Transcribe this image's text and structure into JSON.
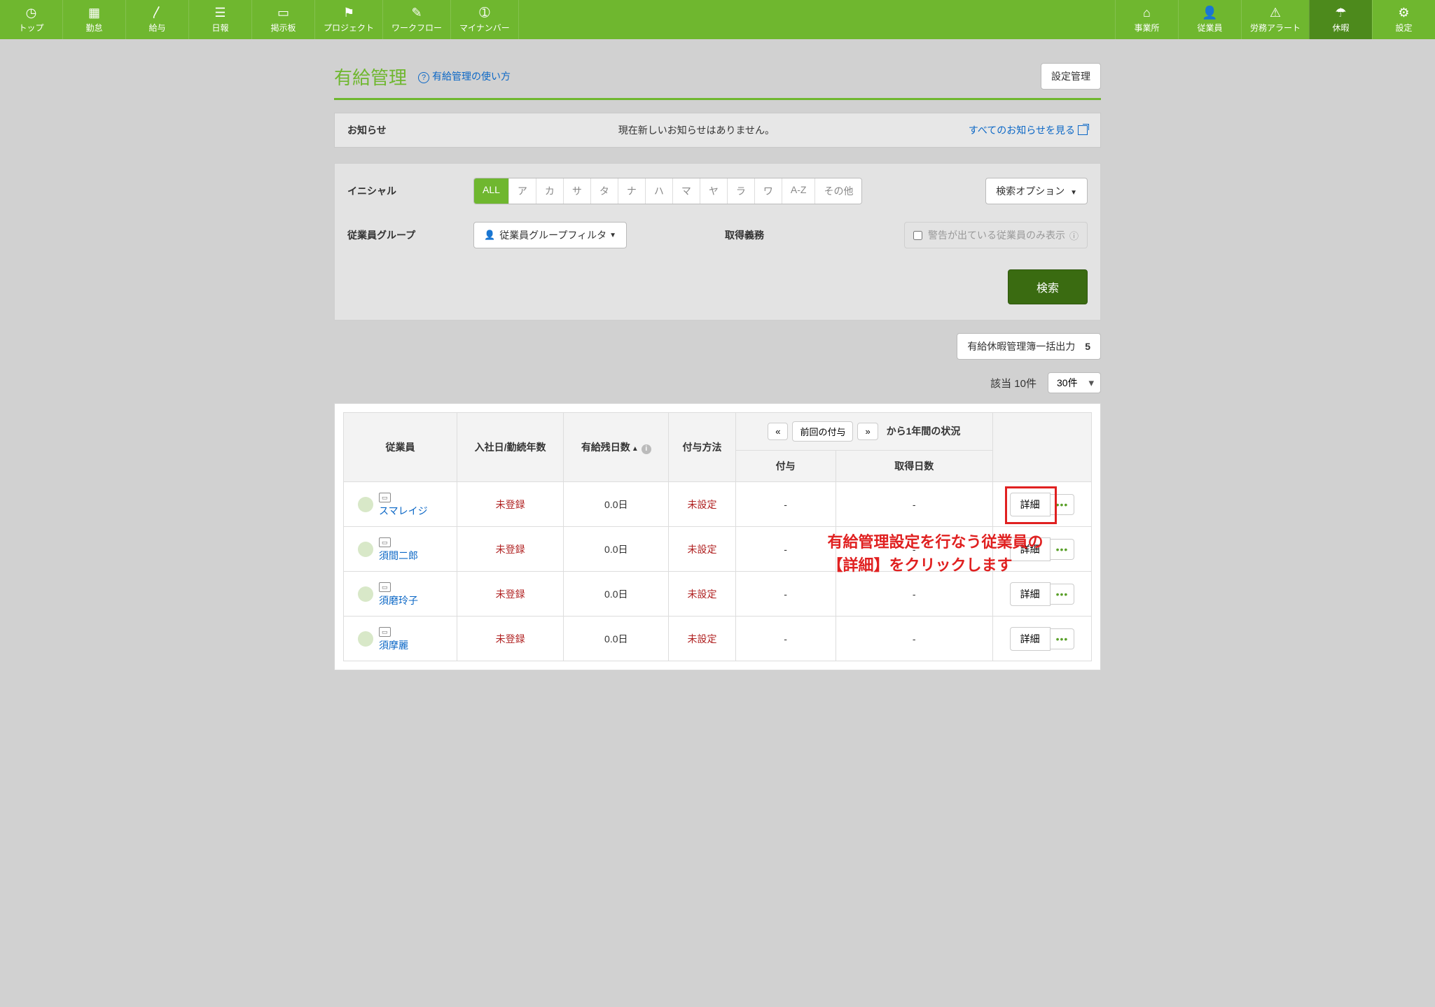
{
  "nav_left": [
    {
      "key": "top",
      "label": "トップ",
      "icon": "◷"
    },
    {
      "key": "attendance",
      "label": "勤怠",
      "icon": "▦"
    },
    {
      "key": "salary",
      "label": "給与",
      "icon": "〳"
    },
    {
      "key": "daily",
      "label": "日報",
      "icon": "☰"
    },
    {
      "key": "board",
      "label": "掲示板",
      "icon": "▭"
    },
    {
      "key": "project",
      "label": "プロジェクト",
      "icon": "⚑"
    },
    {
      "key": "workflow",
      "label": "ワークフロー",
      "icon": "✎"
    },
    {
      "key": "mynumber",
      "label": "マイナンバー",
      "icon": "➀"
    }
  ],
  "nav_right": [
    {
      "key": "office",
      "label": "事業所",
      "icon": "⌂"
    },
    {
      "key": "employees",
      "label": "従業員",
      "icon": "👤"
    },
    {
      "key": "labor-alert",
      "label": "労務アラート",
      "icon": "⚠"
    },
    {
      "key": "vacation",
      "label": "休暇",
      "icon": "☂",
      "active": true
    },
    {
      "key": "settings",
      "label": "設定",
      "icon": "⚙"
    }
  ],
  "header": {
    "title": "有給管理",
    "help_text": "有給管理の使い方",
    "settings_btn": "設定管理"
  },
  "notice": {
    "label": "お知らせ",
    "body": "現在新しいお知らせはありません。",
    "link": "すべてのお知らせを見る"
  },
  "filter": {
    "initial_label": "イニシャル",
    "initials": [
      "ALL",
      "ア",
      "カ",
      "サ",
      "タ",
      "ナ",
      "ハ",
      "マ",
      "ヤ",
      "ラ",
      "ワ",
      "A-Z",
      "その他"
    ],
    "initial_active": "ALL",
    "search_options": "検索オプション",
    "group_label": "従業員グループ",
    "group_filter_btn": "従業員グループフィルタ",
    "obligation_label": "取得義務",
    "warning_only_label": "警告が出ている従業員のみ表示",
    "search_btn": "検索"
  },
  "bulk": {
    "label": "有給休暇管理簿一括出力",
    "count": "5"
  },
  "results": {
    "hit_label": "該当 10件",
    "per_page": "30件"
  },
  "table": {
    "headers": {
      "employee": "従業員",
      "hire_tenure": "入社日/勤続年数",
      "remaining": "有給残日数",
      "method": "付与方法",
      "prev_grant": "前回の付与",
      "year_status_suffix": "から1年間の状況",
      "grant": "付与",
      "taken": "取得日数"
    },
    "rows": [
      {
        "name": "スマレイジ",
        "hire": "未登録",
        "remaining": "0.0日",
        "method": "未設定",
        "grant": "-",
        "taken": "-",
        "action": "詳細",
        "highlight": true
      },
      {
        "name": "須間二郎",
        "hire": "未登録",
        "remaining": "0.0日",
        "method": "未設定",
        "grant": "-",
        "taken": "-",
        "action": "詳細"
      },
      {
        "name": "須磨玲子",
        "hire": "未登録",
        "remaining": "0.0日",
        "method": "未設定",
        "grant": "-",
        "taken": "-",
        "action": "詳細"
      },
      {
        "name": "須摩麗",
        "hire": "未登録",
        "remaining": "0.0日",
        "method": "未設定",
        "grant": "-",
        "taken": "-",
        "action": "詳細"
      }
    ]
  },
  "annotation": {
    "line1": "有給管理設定を行なう従業員の",
    "line2": "【詳細】をクリックします"
  }
}
